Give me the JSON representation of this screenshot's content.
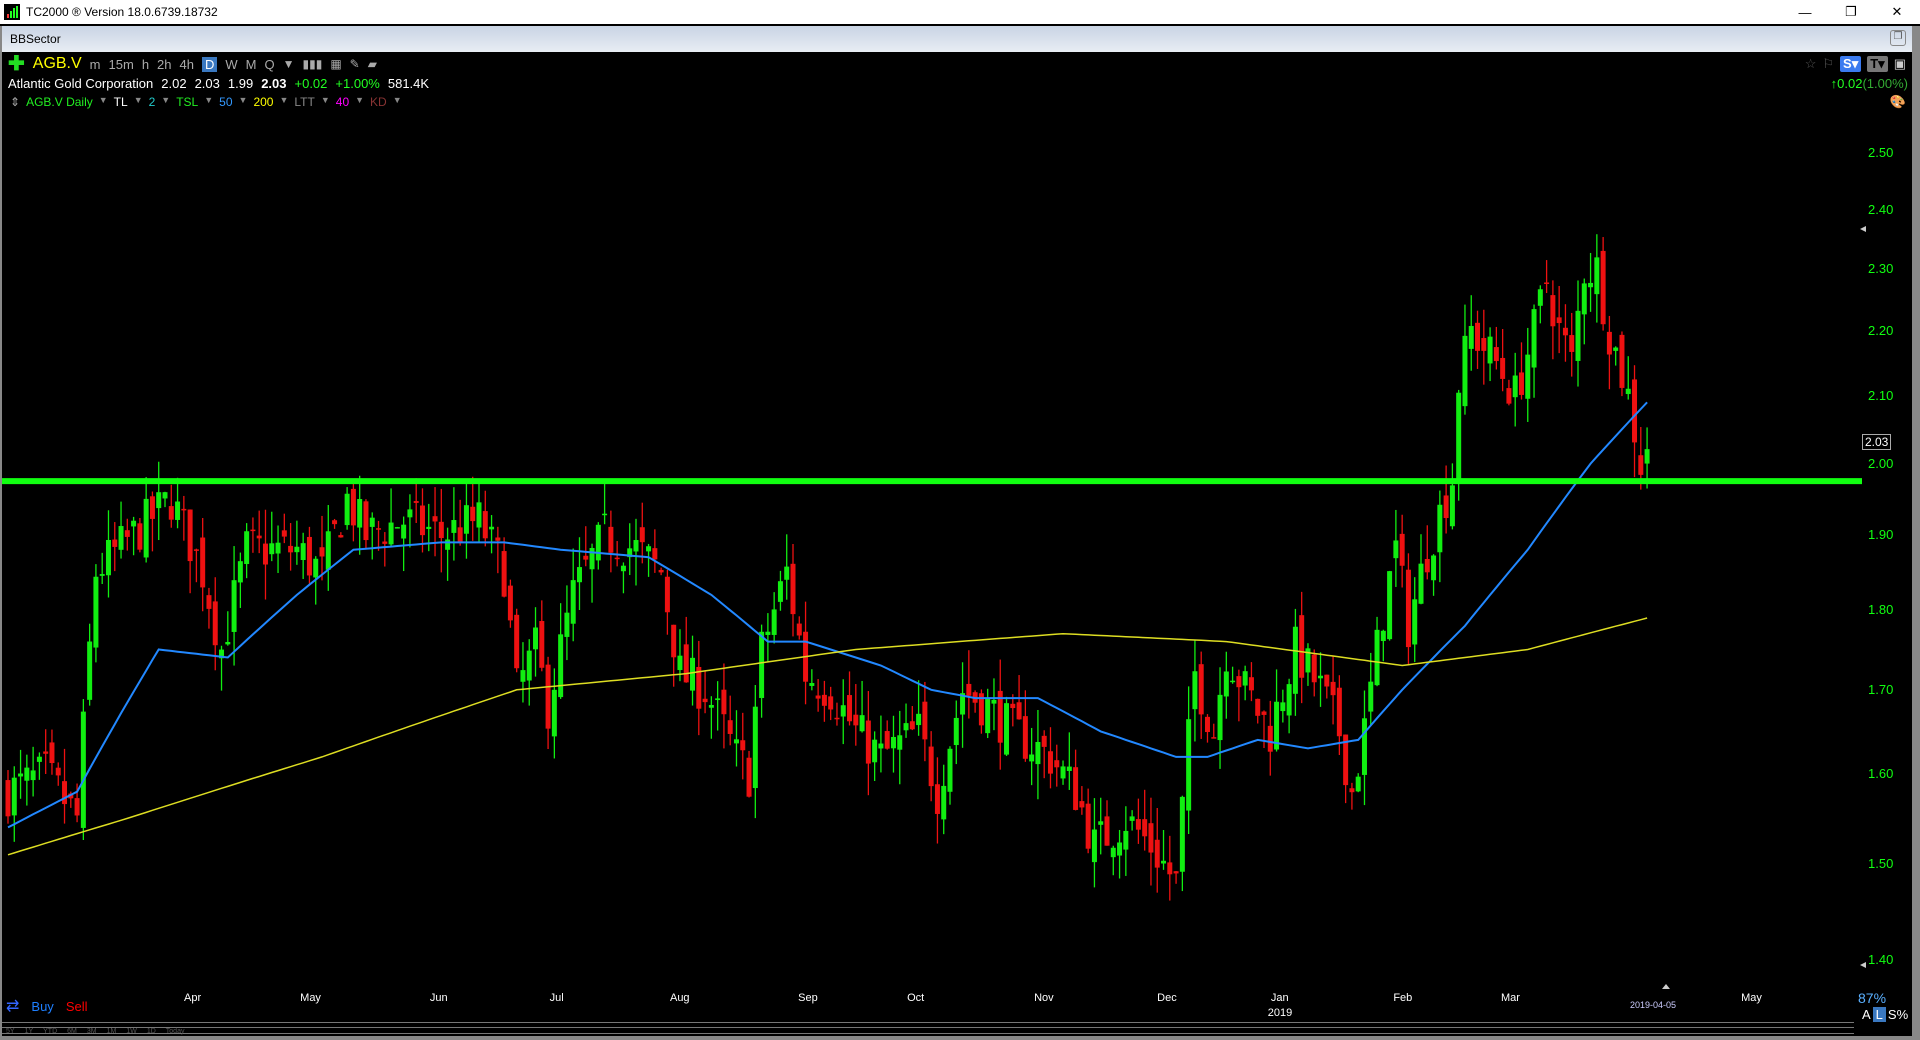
{
  "window": {
    "title": "TC2000 ® Version 18.0.6739.18732",
    "pane": "BBSector"
  },
  "toolbar": {
    "symbol": "AGB.V",
    "timeframes": [
      "m",
      "15m",
      "h",
      "2h",
      "4h",
      "D",
      "W",
      "M",
      "Q"
    ],
    "active": "D"
  },
  "quote": {
    "name": "Atlantic Gold Corporation",
    "open": "2.02",
    "high": "2.03",
    "low": "1.99",
    "last": "2.03",
    "change": "+0.02",
    "change_pct": "+1.00%",
    "volume": "581.4K",
    "header_change": "0.02",
    "header_pct": "(1.00%)"
  },
  "indicators": [
    {
      "label": "AGB.V Daily",
      "color": "#22ee22"
    },
    {
      "label": "TL",
      "color": "#ffffff"
    },
    {
      "label": "2",
      "color": "#22cccc"
    },
    {
      "label": "TSL",
      "color": "#22ee22"
    },
    {
      "label": "50",
      "color": "#3399ff"
    },
    {
      "label": "200",
      "color": "#ffff00"
    },
    {
      "label": "LTT",
      "color": "#888888"
    },
    {
      "label": "40",
      "color": "#ff00ff"
    },
    {
      "label": "KD",
      "color": "#883333"
    }
  ],
  "footer": {
    "buy": "Buy",
    "sell": "Sell",
    "zoom": "87%",
    "scale": [
      "A",
      "L",
      "S%"
    ],
    "ranges": [
      "5Y",
      "1Y",
      "YTD",
      "6M",
      "3M",
      "1M",
      "1W",
      "1D",
      "Today"
    ]
  },
  "chart_data": {
    "type": "candlestick",
    "symbol": "AGB.V",
    "interval": "Daily",
    "scale": "log",
    "ylim": [
      1.4,
      2.5
    ],
    "yticks": [
      "2.50",
      "2.40",
      "2.30",
      "2.20",
      "2.10",
      "2.00",
      "1.90",
      "1.80",
      "1.70",
      "1.60",
      "1.50",
      "1.40"
    ],
    "xticks": [
      {
        "label": "Apr",
        "bar": 36
      },
      {
        "label": "May",
        "bar": 59
      },
      {
        "label": "Jun",
        "bar": 84
      },
      {
        "label": "Jul",
        "bar": 107
      },
      {
        "label": "Aug",
        "bar": 131
      },
      {
        "label": "Sep",
        "bar": 156
      },
      {
        "label": "Oct",
        "bar": 177
      },
      {
        "label": "Nov",
        "bar": 202
      },
      {
        "label": "Dec",
        "bar": 226
      },
      {
        "label": "Jan",
        "bar": 248
      },
      {
        "label": "Feb",
        "bar": 272
      },
      {
        "label": "Mar",
        "bar": 293
      },
      {
        "label": "May",
        "bar": 340
      }
    ],
    "year_label": "2019",
    "last_date": "2019-04-05",
    "last_price": "2.03",
    "bars": 262,
    "close_path": [
      [
        0,
        1.58
      ],
      [
        6,
        1.6
      ],
      [
        11,
        1.55
      ],
      [
        14,
        1.85
      ],
      [
        20,
        1.9
      ],
      [
        26,
        1.95
      ],
      [
        31,
        1.85
      ],
      [
        34,
        1.75
      ],
      [
        38,
        1.88
      ],
      [
        46,
        1.88
      ],
      [
        50,
        1.85
      ],
      [
        54,
        1.95
      ],
      [
        57,
        1.9
      ],
      [
        63,
        1.92
      ],
      [
        69,
        1.9
      ],
      [
        75,
        1.92
      ],
      [
        79,
        1.85
      ],
      [
        81,
        1.7
      ],
      [
        84,
        1.75
      ],
      [
        86,
        1.68
      ],
      [
        90,
        1.82
      ],
      [
        95,
        1.9
      ],
      [
        100,
        1.88
      ],
      [
        104,
        1.85
      ],
      [
        107,
        1.72
      ],
      [
        111,
        1.7
      ],
      [
        116,
        1.62
      ],
      [
        118,
        1.6
      ],
      [
        120,
        1.75
      ],
      [
        124,
        1.85
      ],
      [
        127,
        1.72
      ],
      [
        131,
        1.7
      ],
      [
        135,
        1.65
      ],
      [
        139,
        1.62
      ],
      [
        145,
        1.65
      ],
      [
        148,
        1.58
      ],
      [
        152,
        1.7
      ],
      [
        156,
        1.68
      ],
      [
        160,
        1.65
      ],
      [
        166,
        1.62
      ],
      [
        170,
        1.58
      ],
      [
        173,
        1.52
      ],
      [
        178,
        1.55
      ],
      [
        182,
        1.52
      ],
      [
        186,
        1.48
      ],
      [
        189,
        1.72
      ],
      [
        192,
        1.65
      ],
      [
        194,
        1.75
      ],
      [
        197,
        1.7
      ],
      [
        201,
        1.65
      ],
      [
        205,
        1.75
      ],
      [
        209,
        1.7
      ],
      [
        212,
        1.65
      ],
      [
        214,
        1.58
      ],
      [
        216,
        1.65
      ],
      [
        219,
        1.8
      ],
      [
        221,
        1.88
      ],
      [
        223,
        1.78
      ],
      [
        226,
        1.88
      ],
      [
        228,
        1.93
      ],
      [
        230,
        1.98
      ],
      [
        231,
        2.12
      ],
      [
        233,
        2.2
      ],
      [
        237,
        2.15
      ],
      [
        240,
        2.1
      ],
      [
        243,
        2.2
      ],
      [
        245,
        2.28
      ],
      [
        247,
        2.2
      ],
      [
        249,
        2.15
      ],
      [
        251,
        2.3
      ],
      [
        253,
        2.3
      ],
      [
        255,
        2.2
      ],
      [
        258,
        2.1
      ],
      [
        260,
        2.0
      ],
      [
        261,
        2.03
      ]
    ],
    "series": [
      {
        "name": "50",
        "color": "#2288ff",
        "points": [
          [
            0,
            1.54
          ],
          [
            11,
            1.58
          ],
          [
            24,
            1.75
          ],
          [
            35,
            1.74
          ],
          [
            46,
            1.82
          ],
          [
            55,
            1.88
          ],
          [
            69,
            1.89
          ],
          [
            79,
            1.89
          ],
          [
            88,
            1.88
          ],
          [
            102,
            1.87
          ],
          [
            112,
            1.82
          ],
          [
            121,
            1.76
          ],
          [
            127,
            1.76
          ],
          [
            139,
            1.73
          ],
          [
            147,
            1.7
          ],
          [
            154,
            1.69
          ],
          [
            164,
            1.69
          ],
          [
            174,
            1.65
          ],
          [
            186,
            1.62
          ],
          [
            191,
            1.62
          ],
          [
            199,
            1.64
          ],
          [
            207,
            1.63
          ],
          [
            215,
            1.64
          ],
          [
            222,
            1.7
          ],
          [
            232,
            1.78
          ],
          [
            242,
            1.88
          ],
          [
            252,
            2.0
          ],
          [
            261,
            2.09
          ]
        ]
      },
      {
        "name": "200",
        "color": "#dddd22",
        "points": [
          [
            0,
            1.51
          ],
          [
            19,
            1.55
          ],
          [
            50,
            1.62
          ],
          [
            81,
            1.7
          ],
          [
            108,
            1.72
          ],
          [
            135,
            1.75
          ],
          [
            168,
            1.77
          ],
          [
            194,
            1.76
          ],
          [
            222,
            1.73
          ],
          [
            242,
            1.75
          ],
          [
            261,
            1.79
          ]
        ]
      }
    ],
    "trendline": {
      "price": 1.975,
      "color": "#11ff11"
    }
  }
}
